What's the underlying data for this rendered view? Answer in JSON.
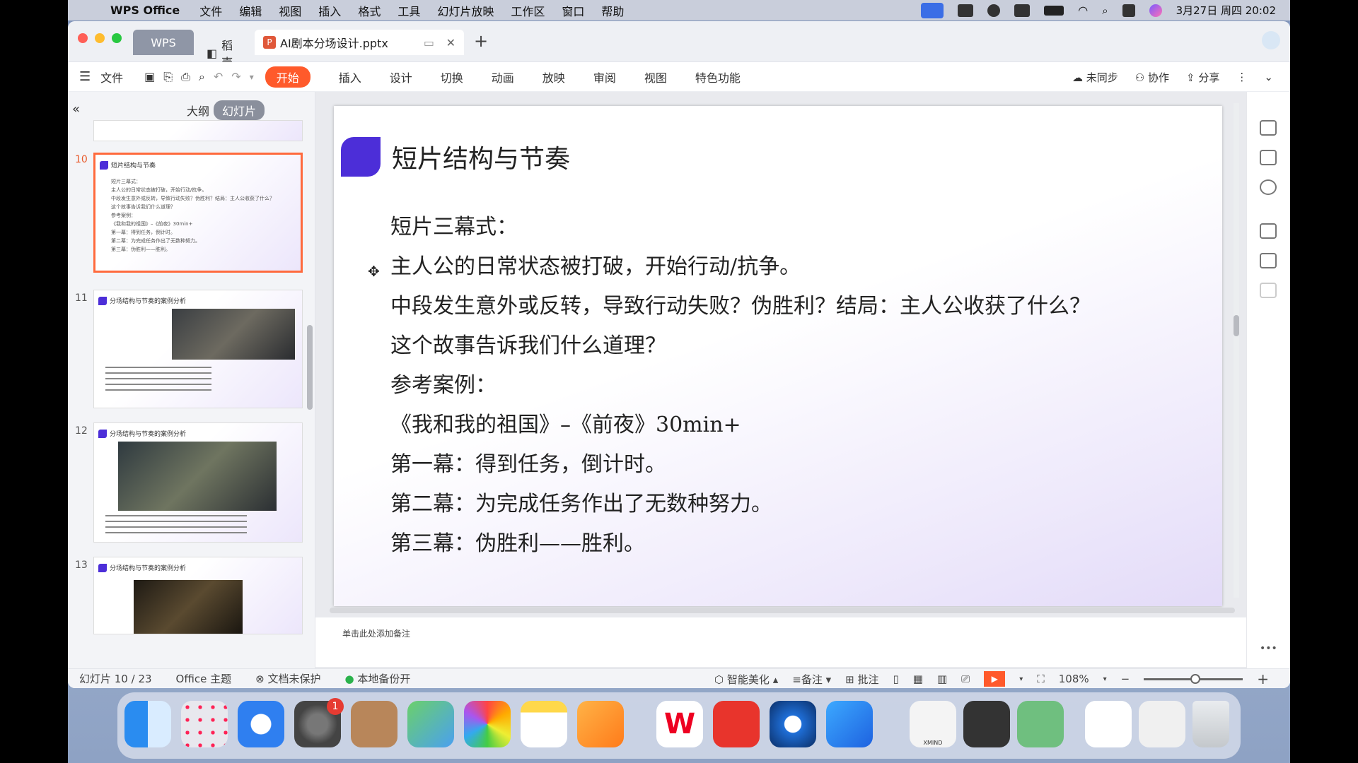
{
  "menubar": {
    "app_name": "WPS Office",
    "items": [
      "文件",
      "编辑",
      "视图",
      "插入",
      "格式",
      "工具",
      "幻灯片放映",
      "工作区",
      "窗口",
      "帮助"
    ],
    "datetime": "3月27日 周四  20:02"
  },
  "tabs": {
    "wps": "WPS",
    "daoke": "稻壳",
    "doc": "AI剧本分场设计.pptx"
  },
  "toolbar": {
    "file": "文件",
    "start": "开始",
    "items": [
      "插入",
      "设计",
      "切换",
      "动画",
      "放映",
      "审阅",
      "视图",
      "特色功能"
    ],
    "sync": "未同步",
    "collab": "协作",
    "share": "分享"
  },
  "panel": {
    "outline": "大纲",
    "slides": "幻灯片"
  },
  "thumbs": [
    {
      "num": "10",
      "title": "短片结构与节奏"
    },
    {
      "num": "11",
      "title": "分场结构与节奏的案例分析"
    },
    {
      "num": "12",
      "title": "分场结构与节奏的案例分析"
    },
    {
      "num": "13",
      "title": "分场结构与节奏的案例分析"
    }
  ],
  "slide": {
    "title": "短片结构与节奏",
    "lines": [
      "短片三幕式：",
      "主人公的日常状态被打破，开始行动/抗争。",
      "中段发生意外或反转，导致行动失败？伪胜利？结局：主人公收获了什么？",
      "这个故事告诉我们什么道理？",
      "参考案例：",
      "《我和我的祖国》–《前夜》30min+",
      "第一幕：得到任务，倒计时。",
      "第二幕：为完成任务作出了无数种努力。",
      "第三幕：伪胜利——胜利。"
    ]
  },
  "notes_placeholder": "单击此处添加备注",
  "status": {
    "slide_count": "幻灯片 10 / 23",
    "theme": "Office 主题",
    "protect": "文档未保护",
    "backup": "本地备份开",
    "beautify": "智能美化",
    "notes": "备注",
    "comment": "批注",
    "zoom": "108%"
  },
  "dock": {
    "xmind_label": "XMIND",
    "settings_badge": "1"
  },
  "colors": {
    "accent": "#ff5a2b",
    "slide_marker": "#4c2ed8"
  }
}
